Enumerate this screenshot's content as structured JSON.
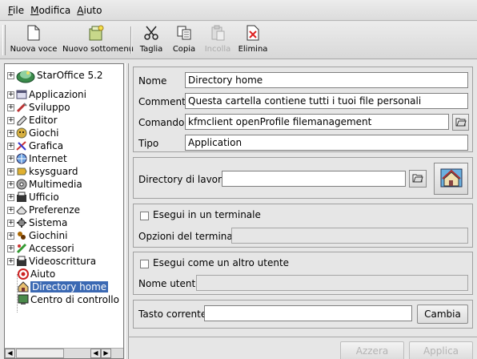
{
  "menubar": {
    "items": [
      "File",
      "Modifica",
      "Aiuto"
    ]
  },
  "toolbar": {
    "new_item": "Nuova voce",
    "new_submenu": "Nuovo sottomenu",
    "cut": "Taglia",
    "copy": "Copia",
    "paste": "Incolla",
    "delete": "Elimina"
  },
  "tree": {
    "items": [
      "StarOffice 5.2",
      "Applicazioni",
      "Sviluppo",
      "Editor",
      "Giochi",
      "Grafica",
      "Internet",
      "ksysguard",
      "Multimedia",
      "Ufficio",
      "Preferenze",
      "Sistema",
      "Giochini",
      "Accessori",
      "Videoscrittura",
      "Aiuto",
      "Directory home",
      "Centro di controllo"
    ],
    "selected": "Directory home"
  },
  "form": {
    "name_label": "Nome",
    "name_value": "Directory home",
    "comment_label": "Commento",
    "comment_value": "Questa cartella contiene tutti i tuoi file personali",
    "command_label": "Comando",
    "command_value": "kfmclient openProfile filemanagement",
    "type_label": "Tipo",
    "type_value": "Application",
    "workdir_label": "Directory di lavoro",
    "workdir_value": "",
    "run_in_terminal_label": "Esegui in un terminale",
    "terminal_options_label": "Opzioni del terminale",
    "terminal_options_value": "",
    "run_as_user_label": "Esegui come un altro utente",
    "username_label": "Nome utente",
    "username_value": "",
    "shortcut_label": "Tasto corrente",
    "shortcut_value": "",
    "change_button": "Cambia"
  },
  "footer": {
    "reset": "Azzera",
    "apply": "Applica"
  },
  "colors": {
    "selection": "#3b69b3",
    "window_bg": "#e6e6e6"
  }
}
